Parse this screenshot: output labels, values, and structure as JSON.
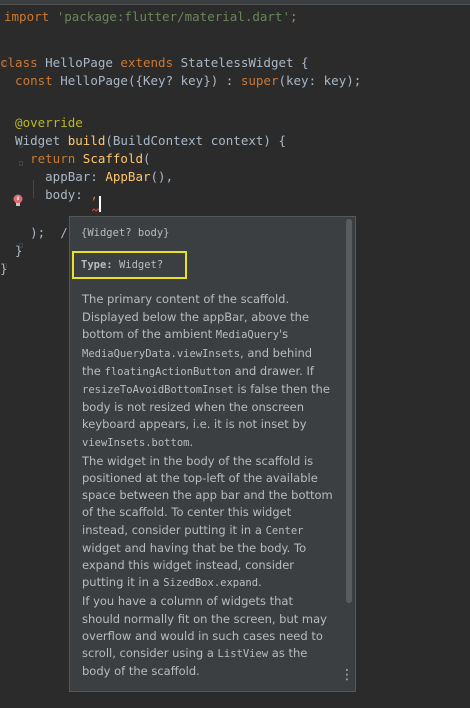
{
  "code": {
    "lines": [
      {
        "parts": [
          {
            "t": "import ",
            "c": "kw"
          },
          {
            "t": "'package:flutter/material.dart'",
            "c": "str"
          },
          {
            "t": ";",
            "c": "kw"
          }
        ]
      },
      {
        "parts": []
      },
      {
        "parts": [
          {
            "t": "class ",
            "c": "kw"
          },
          {
            "t": "HelloPage ",
            "c": ""
          },
          {
            "t": "extends ",
            "c": "kw"
          },
          {
            "t": "StatelessWidget {",
            "c": ""
          }
        ]
      },
      {
        "parts": [
          {
            "t": "  const ",
            "c": "kw"
          },
          {
            "t": "HelloPage({Key? key}) : ",
            "c": ""
          },
          {
            "t": "super",
            "c": "kw"
          },
          {
            "t": "(key: key);",
            "c": ""
          }
        ]
      },
      {
        "parts": []
      },
      {
        "parts": [
          {
            "t": "  @override",
            "c": "ann"
          }
        ]
      },
      {
        "parts": [
          {
            "t": "  Widget ",
            "c": ""
          },
          {
            "t": "build",
            "c": "fn"
          },
          {
            "t": "(BuildContext context) {",
            "c": ""
          }
        ]
      },
      {
        "parts": [
          {
            "t": "    return ",
            "c": "kw"
          },
          {
            "t": "Scaffold",
            "c": "cls"
          },
          {
            "t": "(",
            "c": ""
          }
        ]
      },
      {
        "parts": [
          {
            "t": "      appBar: ",
            "c": ""
          },
          {
            "t": "AppBar",
            "c": "cls"
          },
          {
            "t": "(),",
            "c": ""
          }
        ]
      },
      {
        "parts": [
          {
            "t": "      body: ",
            "c": ""
          },
          {
            "t": ",",
            "c": "kw"
          }
        ]
      },
      {
        "parts": []
      },
      {
        "parts": [
          {
            "t": "    );  /",
            "c": ""
          }
        ]
      },
      {
        "parts": [
          {
            "t": "  }",
            "c": ""
          }
        ]
      },
      {
        "parts": [
          {
            "t": "}",
            "c": ""
          }
        ]
      }
    ]
  },
  "popup": {
    "signature": "{Widget? body}",
    "type_label": "Type:",
    "type_value": "Widget?",
    "paragraphs": [
      [
        {
          "t": "The primary content of the scaffold.",
          "code": false
        }
      ],
      [
        {
          "t": "Displayed below the appBar, above the bottom of the ambient ",
          "code": false
        },
        {
          "t": "MediaQuery",
          "code": true
        },
        {
          "t": "'s ",
          "code": false
        },
        {
          "t": "MediaQueryData.viewInsets",
          "code": true
        },
        {
          "t": ", and behind the ",
          "code": false
        },
        {
          "t": "floatingActionButton",
          "code": true
        },
        {
          "t": " and drawer. If ",
          "code": false
        },
        {
          "t": "resizeToAvoidBottomInset",
          "code": true
        },
        {
          "t": " is false then the body is not resized when the onscreen keyboard appears, i.e. it is not inset by ",
          "code": false
        },
        {
          "t": "viewInsets.bottom",
          "code": true
        },
        {
          "t": ".",
          "code": false
        }
      ],
      [
        {
          "t": "The widget in the body of the scaffold is positioned at the top-left of the available space between the app bar and the bottom of the scaffold. To center this widget instead, consider putting it in a ",
          "code": false
        },
        {
          "t": "Center",
          "code": true
        },
        {
          "t": " widget and having that be the body. To expand this widget instead, consider putting it in a ",
          "code": false
        },
        {
          "t": "SizedBox.expand",
          "code": true
        },
        {
          "t": ".",
          "code": false
        }
      ],
      [
        {
          "t": "If you have a column of widgets that should normally fit on the screen, but may overflow and would in such cases need to scroll, consider using a ",
          "code": false
        },
        {
          "t": "ListView",
          "code": true
        },
        {
          "t": " as the body of the scaffold.",
          "code": false
        }
      ]
    ],
    "more_icon": "⋮"
  },
  "colors": {
    "background": "#2b2b2b",
    "keyword": "#cc7832",
    "string": "#6a8759",
    "annotation": "#bbb529",
    "popup_bg": "#3c3f41",
    "highlight_box": "#e8e31b"
  }
}
